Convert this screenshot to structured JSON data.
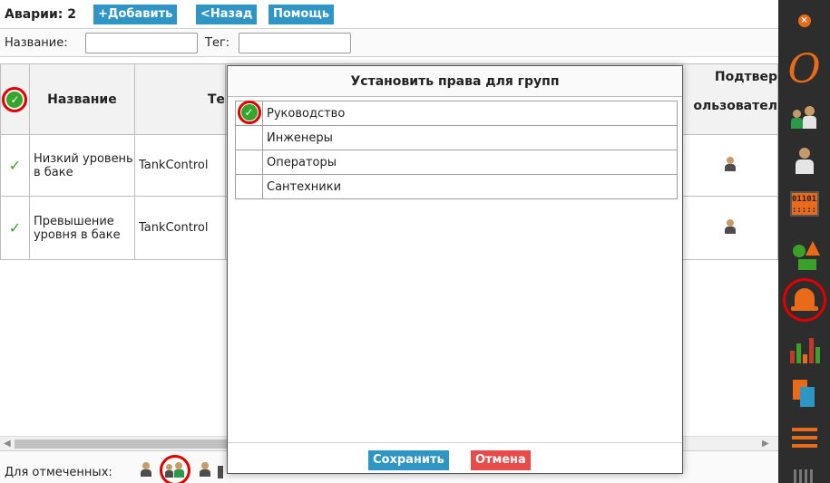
{
  "header": {
    "title": "Аварии: 2",
    "add_label": "+Добавить",
    "back_label": "<Назад",
    "help_label": "Помощь"
  },
  "filters": {
    "name_label": "Название:",
    "name_value": "",
    "tag_label": "Тег:",
    "tag_value": ""
  },
  "table": {
    "columns": {
      "name": "Название",
      "tag": "Те",
      "confirm": "Подтвер",
      "user": "ользовател"
    },
    "rows": [
      {
        "name": "Низкий уровень в баке",
        "tag": "TankControl",
        "checked": true
      },
      {
        "name": "Превышение уровня в баке",
        "tag": "TankControl",
        "checked": true
      }
    ]
  },
  "footer": {
    "for_selected_label": "Для отмеченных:"
  },
  "modal": {
    "title": "Установить права для групп",
    "groups": [
      {
        "name": "Руководство",
        "checked": true
      },
      {
        "name": "Инженеры",
        "checked": false
      },
      {
        "name": "Операторы",
        "checked": false
      },
      {
        "name": "Сантехники",
        "checked": false
      }
    ],
    "save_label": "Сохранить",
    "cancel_label": "Отмена"
  },
  "sidebar": {
    "items": [
      "close-icon",
      "logo-icon",
      "groups-icon",
      "user-icon",
      "binary-data-icon",
      "shapes-icon",
      "alarm-bell-icon",
      "bar-chart-icon",
      "documents-icon",
      "menu-icon"
    ]
  },
  "colors": {
    "accent_blue": "#2e95c5",
    "cancel_red": "#e94a4a",
    "check_green": "#35a62b",
    "sidebar_bg": "#2d2d2d",
    "highlight_red": "#e00000",
    "orange": "#e96a18"
  }
}
